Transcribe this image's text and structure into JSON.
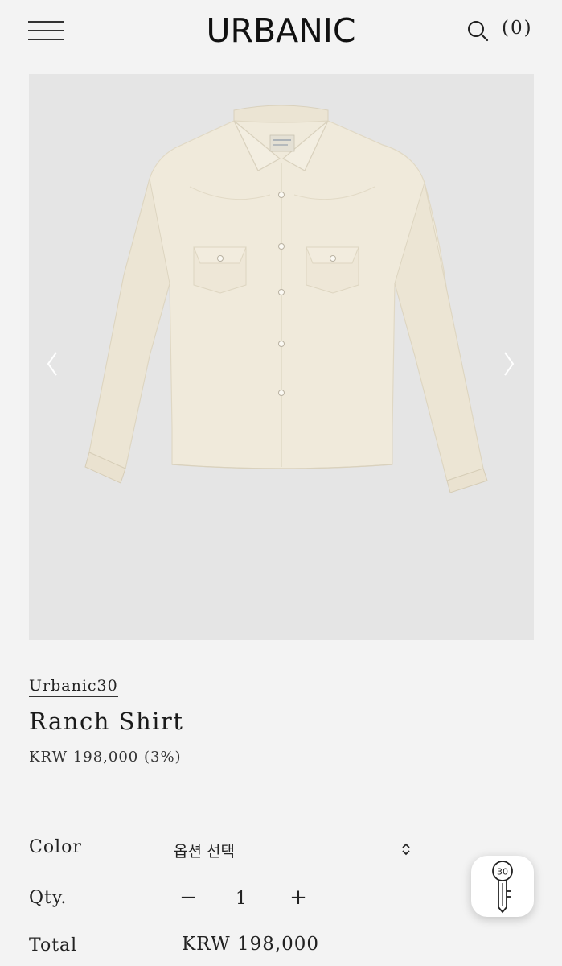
{
  "header": {
    "logo": "URBANIC",
    "cart_count": "(0)",
    "icons": {
      "menu": "hamburger-menu-icon",
      "search": "search-icon"
    }
  },
  "gallery": {
    "icons": {
      "prev": "chevron-left-icon",
      "next": "chevron-right-icon"
    }
  },
  "product": {
    "brand": "Urbanic30",
    "name": "Ranch Shirt",
    "price": "KRW 198,000 (3%)"
  },
  "options": {
    "color_label": "Color",
    "color_value": "옵션 선택",
    "qty_label": "Qty.",
    "qty_minus": "−",
    "qty_value": "1",
    "qty_plus": "+",
    "total_label": "Total",
    "total_value": "KRW 198,000"
  },
  "fab": {
    "badge": "30",
    "icon": "key-icon"
  },
  "colors": {
    "background": "#f3f3f3",
    "image_background": "#e5e5e5",
    "shirt": "#f0eadb",
    "text": "#222222"
  }
}
